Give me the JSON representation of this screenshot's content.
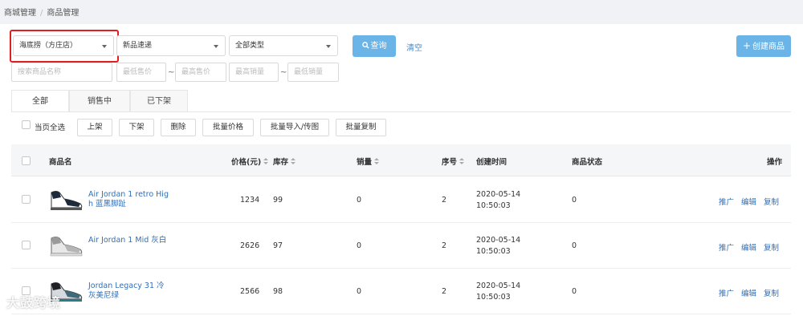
{
  "breadcrumb": [
    "商城管理",
    "商品管理"
  ],
  "filters": {
    "store": "海底捞（方庄店）",
    "order": "新品速递",
    "type": "全部类型",
    "search_btn": "查询",
    "clear": "清空",
    "create_btn": "创建商品",
    "name_ph": "搜索商品名称",
    "min_price_ph": "最低售价",
    "max_price_ph": "最高售价",
    "max_sales_ph": "最高销量",
    "min_sales_ph": "最低销量",
    "tilde": "~"
  },
  "tabs": [
    "全部",
    "销售中",
    "已下架"
  ],
  "actions": {
    "select_page": "当页全选",
    "buttons": [
      "上架",
      "下架",
      "删除",
      "批量价格",
      "批量导入/传图",
      "批量复制"
    ]
  },
  "table": {
    "headers": {
      "name": "商品名",
      "price": "价格(元)",
      "stock": "库存",
      "sales": "销量",
      "seq": "序号",
      "created": "创建时间",
      "status": "商品状态",
      "ops": "操作"
    },
    "rows": [
      {
        "name": "Air Jordan 1 retro High 蓝黑脚趾",
        "price": "1234",
        "stock": "99",
        "sales": "0",
        "seq": "2",
        "date": "2020-05-14",
        "time": "10:50:03",
        "status": "0"
      },
      {
        "name": "Air Jordan 1 Mid 灰白",
        "price": "2626",
        "stock": "97",
        "sales": "0",
        "seq": "2",
        "date": "2020-05-14",
        "time": "10:50:03",
        "status": "0"
      },
      {
        "name": "Jordan Legacy 31 冷灰美尼绿",
        "price": "2566",
        "stock": "98",
        "sales": "0",
        "seq": "2",
        "date": "2020-05-14",
        "time": "10:50:03",
        "status": "0"
      }
    ],
    "row_ops": [
      "推广",
      "编辑",
      "复制"
    ]
  },
  "watermark": "大鼓跨境",
  "colors": {
    "primary": "#6ab4e8",
    "link": "#2f6fb8",
    "highlight": "#e02020"
  }
}
